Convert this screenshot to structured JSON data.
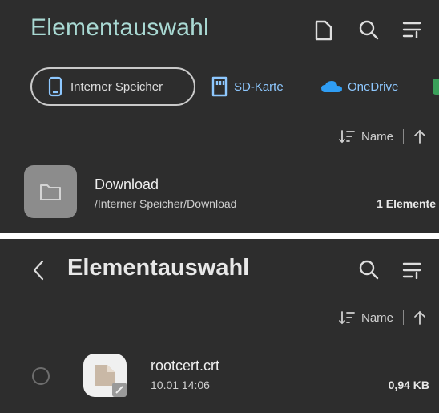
{
  "top_panel": {
    "title": "Elementauswahl",
    "icons": [
      "new-file-icon",
      "search-icon",
      "filter-menu-icon"
    ],
    "storage_chips": [
      {
        "label": "Interner Speicher",
        "icon": "phone-icon",
        "selected": true
      },
      {
        "label": "SD-Karte",
        "icon": "sd-card-icon",
        "selected": false
      },
      {
        "label": "OneDrive",
        "icon": "cloud-icon",
        "selected": false
      }
    ],
    "sort": {
      "label": "Name",
      "icons": [
        "sort-icon",
        "arrow-up-icon"
      ]
    },
    "folder": {
      "name": "Download",
      "path": "/Interner Speicher/Download",
      "count": "1 Elemente"
    }
  },
  "bottom_panel": {
    "title": "Elementauswahl",
    "icons": [
      "back-icon",
      "search-icon",
      "filter-menu-icon"
    ],
    "sort": {
      "label": "Name"
    },
    "file": {
      "name": "rootcert.crt",
      "date": "10.01 14:06",
      "size": "0,94 KB"
    }
  },
  "colors": {
    "background": "#2d2d2d",
    "title_accent": "#a9d9d3",
    "link_blue": "#8ec8ff"
  }
}
